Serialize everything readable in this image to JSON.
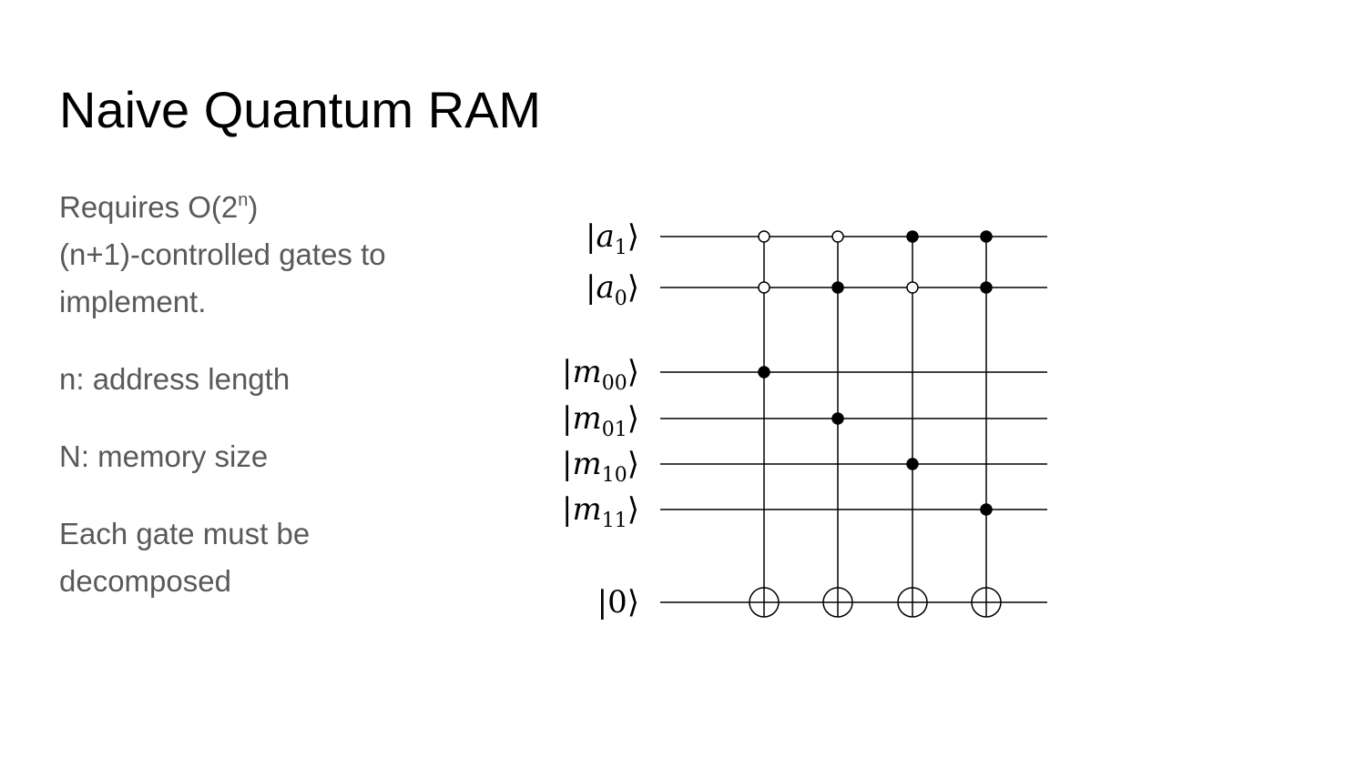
{
  "title": "Naive Quantum RAM",
  "body": {
    "line1_prefix": "Requires O(2",
    "line1_sup": "n",
    "line1_suffix": ")",
    "line2": "(n+1)-controlled gates to",
    "line3": "implement.",
    "address_def": "n: address length",
    "memory_def": "N: memory size",
    "gate_line1": "Each gate must be",
    "gate_line2": "decomposed"
  },
  "circuit": {
    "wires": [
      {
        "var": "a",
        "sub": "1"
      },
      {
        "var": "a",
        "sub": "0"
      },
      {
        "var": "m",
        "sub": "00"
      },
      {
        "var": "m",
        "sub": "01"
      },
      {
        "var": "m",
        "sub": "10"
      },
      {
        "var": "m",
        "sub": "11"
      },
      {
        "var": "",
        "sub": "0"
      }
    ],
    "gates": [
      {
        "a1": "open",
        "a0": "open",
        "mem": "m00"
      },
      {
        "a1": "open",
        "a0": "filled",
        "mem": "m01"
      },
      {
        "a1": "filled",
        "a0": "open",
        "mem": "m10"
      },
      {
        "a1": "filled",
        "a0": "filled",
        "mem": "m11"
      }
    ]
  }
}
